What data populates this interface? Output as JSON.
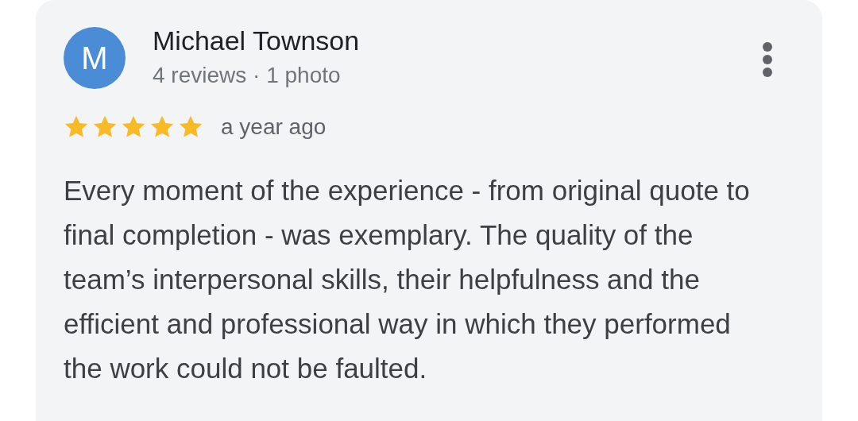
{
  "review": {
    "avatar_letter": "M",
    "author": "Michael Townson",
    "meta": "4 reviews · 1 photo",
    "stars": 5,
    "time": "a year ago",
    "text": "Every moment of the experience - from original quote to final completion - was exemplary. The quality of the team’s interpersonal skills, their helpfulness and the efficient and professional way in which they performed the work could not be faulted."
  }
}
